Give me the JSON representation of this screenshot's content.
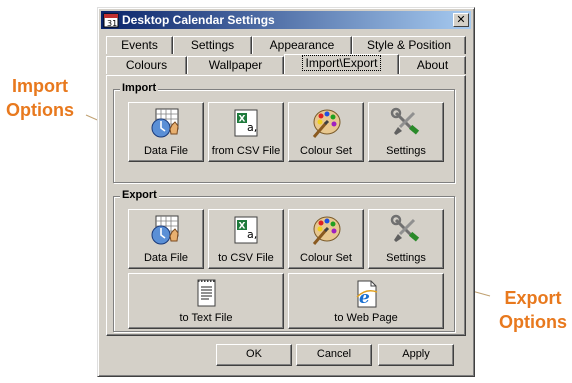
{
  "window": {
    "title": "Desktop Calendar Settings",
    "close_glyph": "✕"
  },
  "tabs_row1": [
    "Events",
    "Settings",
    "Appearance",
    "Style & Position"
  ],
  "tabs_row2": [
    "Colours",
    "Wallpaper",
    "Import\\Export",
    "About"
  ],
  "active_tab": "Import\\Export",
  "import": {
    "label": "Import",
    "buttons": [
      "Data File",
      "from CSV File",
      "Colour Set",
      "Settings"
    ]
  },
  "export": {
    "label": "Export",
    "buttons": [
      "Data File",
      "to CSV File",
      "Colour Set",
      "Settings"
    ],
    "wide_buttons": [
      "to Text File",
      "to Web Page"
    ]
  },
  "dialog_buttons": {
    "ok": "OK",
    "cancel": "Cancel",
    "apply": "Apply"
  },
  "callouts": {
    "import_line1": "Import",
    "import_line2": "Options",
    "export_line1": "Export",
    "export_line2": "Options",
    "color": "#e8791e"
  },
  "icons": {
    "data_file": "calendar-clock-icon",
    "csv_file": "excel-icon",
    "colour_set": "palette-icon",
    "settings": "tools-icon",
    "text_file": "text-document-icon",
    "web_page": "ie-document-icon"
  }
}
